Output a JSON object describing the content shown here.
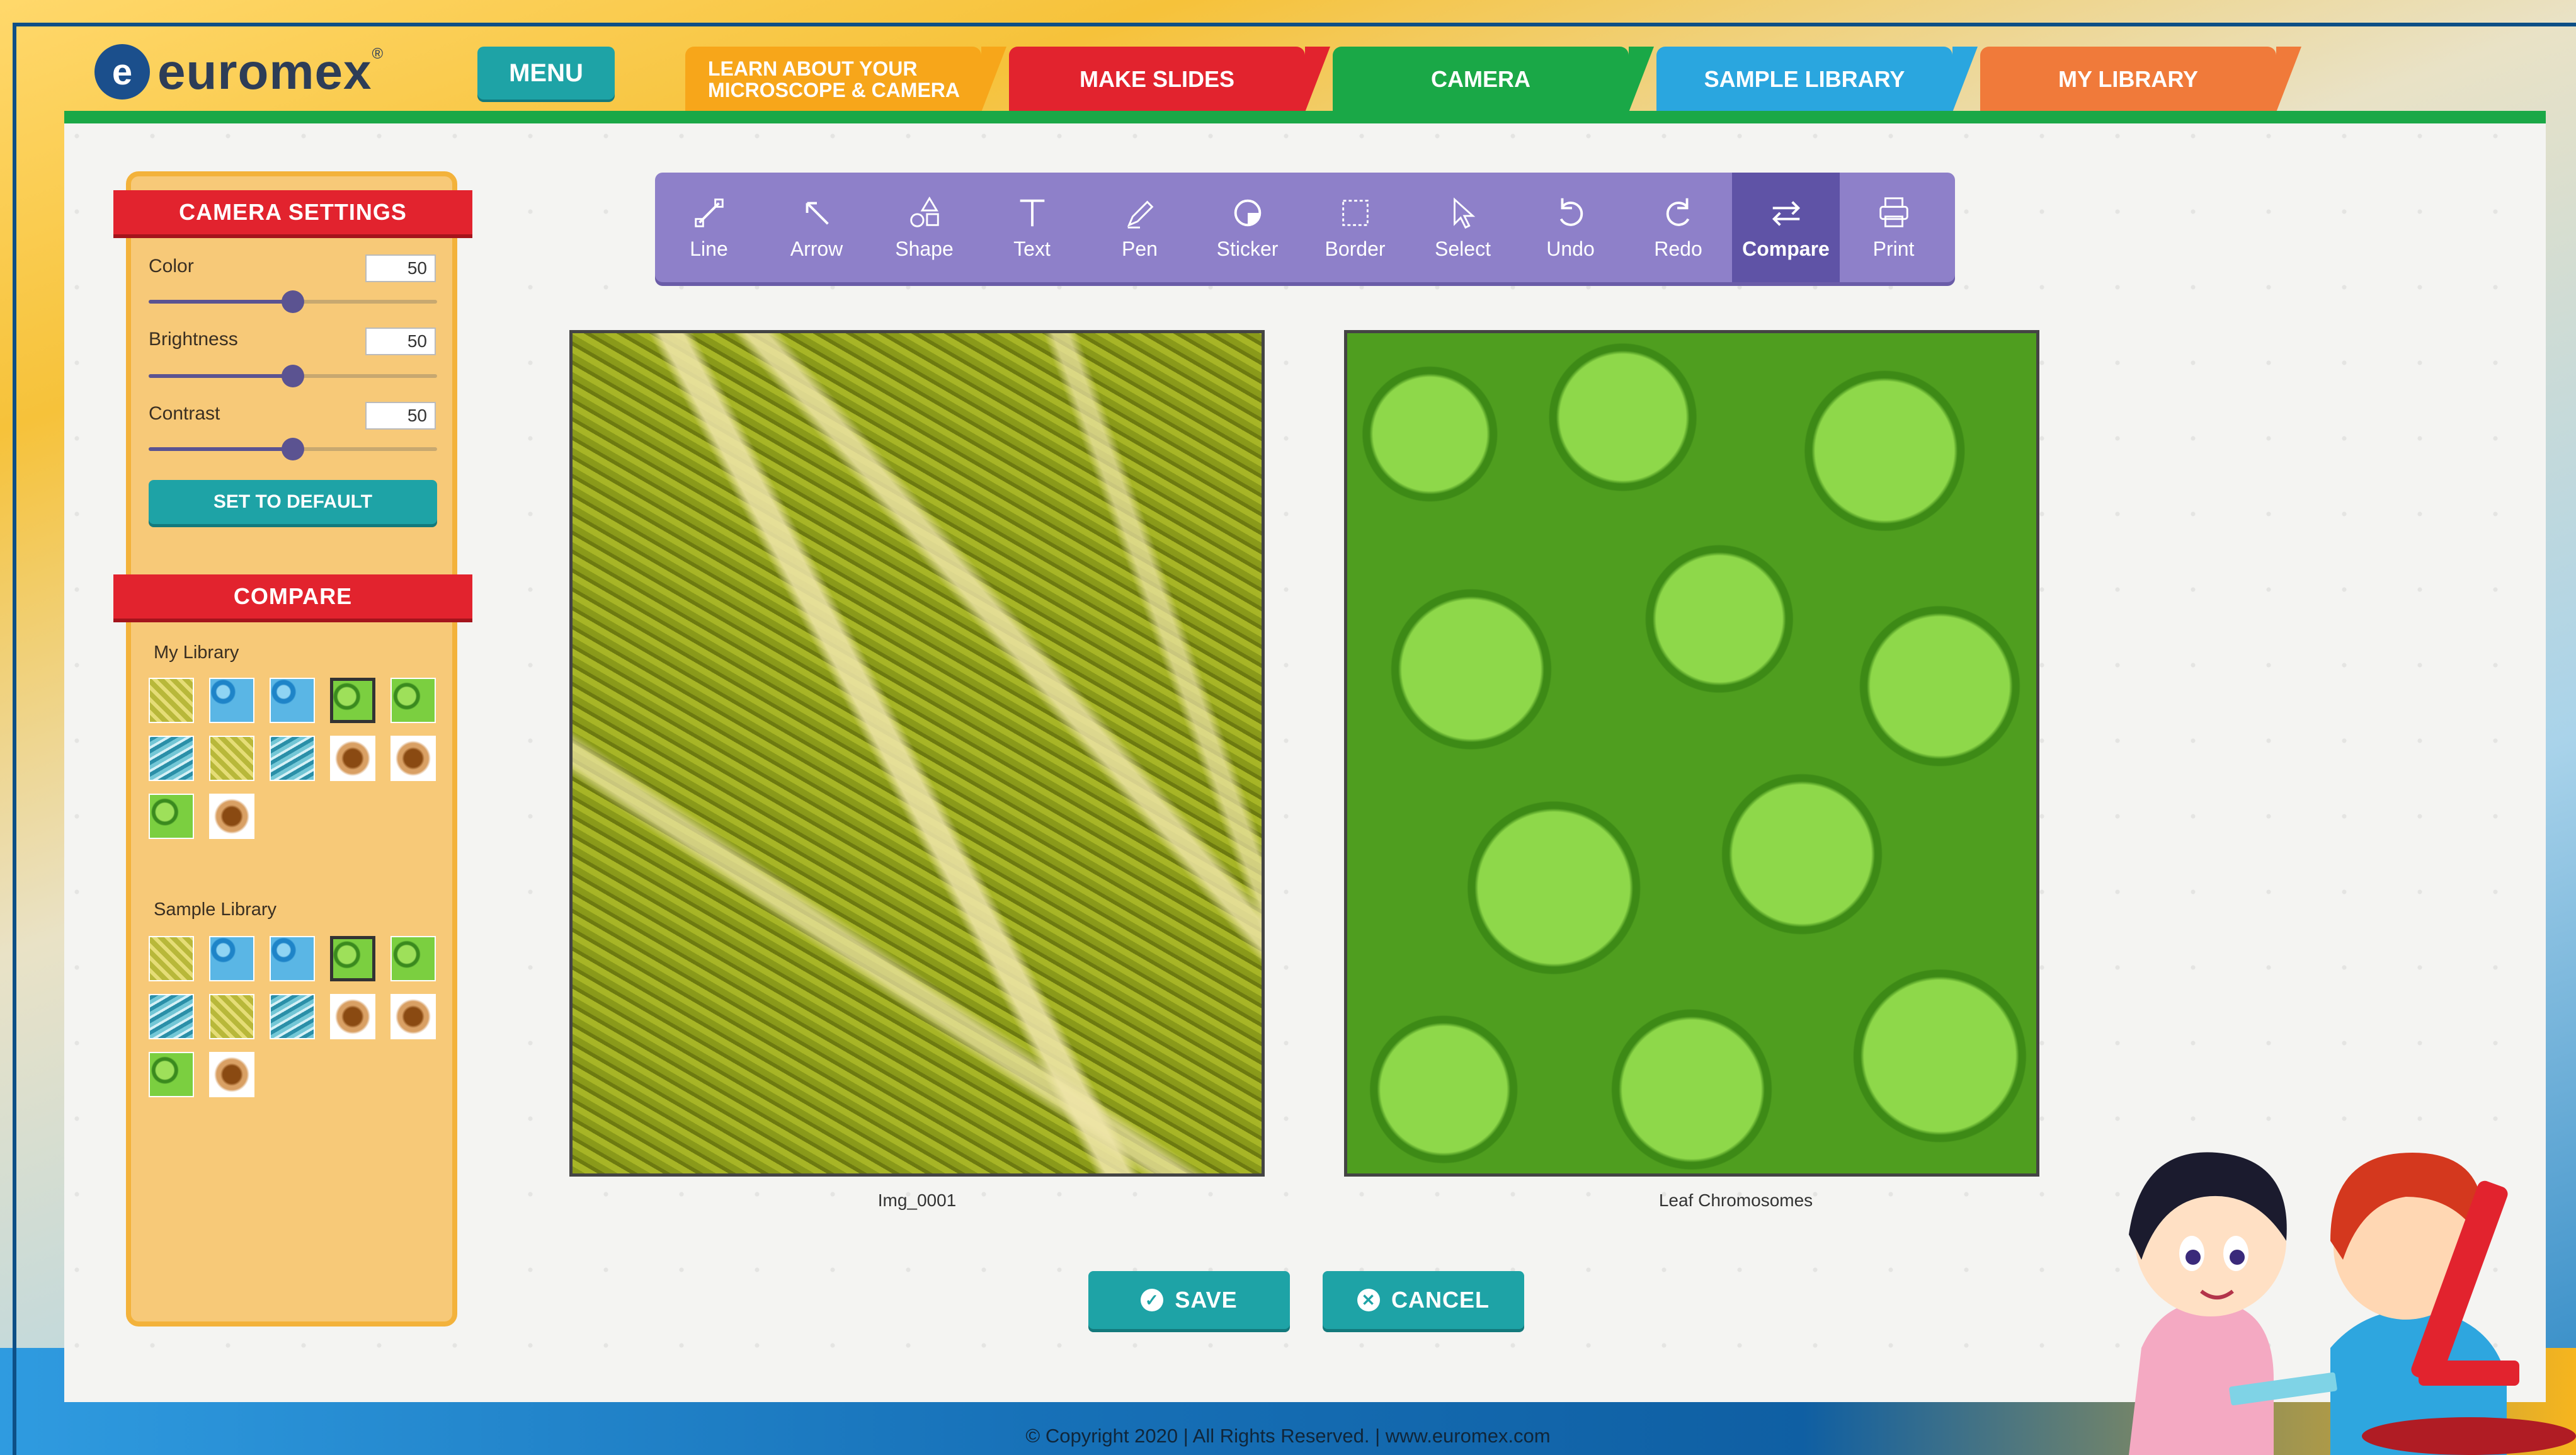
{
  "brand": {
    "name": "euromex",
    "reg": "®",
    "mark": "e"
  },
  "menu_label": "MENU",
  "tabs": [
    {
      "label": "LEARN ABOUT YOUR MICROSCOPE & CAMERA",
      "color": "#f7a61a"
    },
    {
      "label": "MAKE SLIDES",
      "color": "#e2232e"
    },
    {
      "label": "CAMERA",
      "color": "#1aa847",
      "active": true
    },
    {
      "label": "SAMPLE LIBRARY",
      "color": "#2aa6df"
    },
    {
      "label": "MY LIBRARY",
      "color": "#f07a3a"
    }
  ],
  "camera_settings": {
    "title": "CAMERA SETTINGS",
    "color": {
      "label": "Color",
      "value": "50"
    },
    "brightness": {
      "label": "Brightness",
      "value": "50"
    },
    "contrast": {
      "label": "Contrast",
      "value": "50"
    },
    "default_button": "SET TO DEFAULT"
  },
  "compare": {
    "title": "COMPARE",
    "my_library_label": "My Library",
    "sample_library_label": "Sample Library",
    "thumb_types": [
      "yellow",
      "blue",
      "blue",
      "green",
      "green",
      "teal",
      "yellow",
      "teal",
      "brown",
      "brown",
      "green",
      "brown"
    ],
    "selected_index": 3
  },
  "toolbar": [
    {
      "label": "Line",
      "icon": "line-icon"
    },
    {
      "label": "Arrow",
      "icon": "arrow-icon"
    },
    {
      "label": "Shape",
      "icon": "shape-icon"
    },
    {
      "label": "Text",
      "icon": "text-icon"
    },
    {
      "label": "Pen",
      "icon": "pen-icon"
    },
    {
      "label": "Sticker",
      "icon": "sticker-icon"
    },
    {
      "label": "Border",
      "icon": "border-icon"
    },
    {
      "label": "Select",
      "icon": "select-icon"
    },
    {
      "label": "Undo",
      "icon": "undo-icon"
    },
    {
      "label": "Redo",
      "icon": "redo-icon"
    },
    {
      "label": "Compare",
      "icon": "compare-icon",
      "active": true
    },
    {
      "label": "Print",
      "icon": "print-icon"
    }
  ],
  "images": {
    "left_caption": "Img_0001",
    "right_caption": "Leaf Chromosomes"
  },
  "actions": {
    "save": "SAVE",
    "cancel": "CANCEL"
  },
  "footer": "© Copyright 2020  |  All Rights Reserved.  |  www.euromex.com",
  "colors": {
    "accent_teal": "#1ea3a6",
    "ribbon_red": "#e2232e",
    "toolbar_purple": "#8e80c9"
  }
}
